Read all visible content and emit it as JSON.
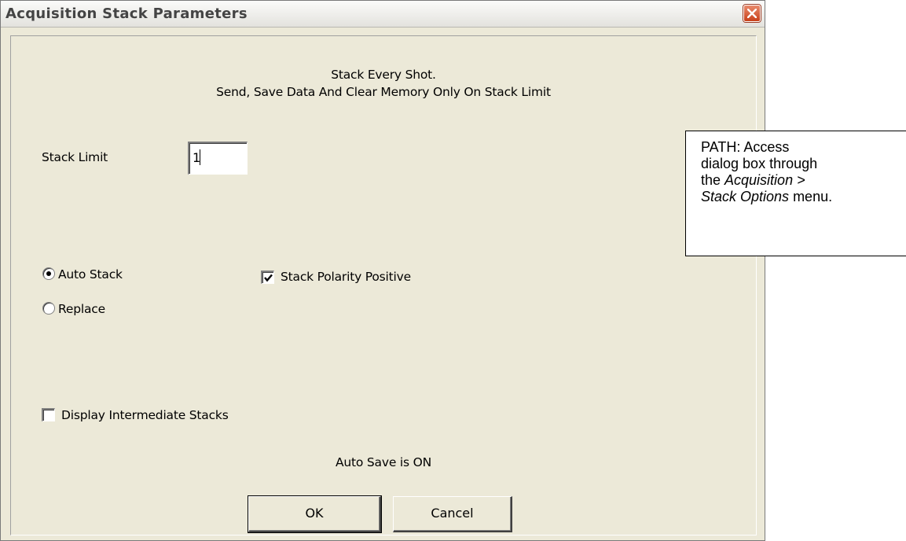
{
  "dialog": {
    "title": "Acquisition Stack Parameters",
    "header_line1": "Stack Every Shot.",
    "header_line2": "Send, Save Data And Clear Memory Only On Stack Limit",
    "stack_limit": {
      "label": "Stack Limit",
      "value": "1"
    },
    "mode_options": [
      {
        "label": "Auto Stack",
        "selected": true
      },
      {
        "label": "Replace",
        "selected": false
      }
    ],
    "stack_polarity": {
      "label": "Stack Polarity Positive",
      "checked": true
    },
    "display_intermediate": {
      "label": "Display Intermediate Stacks",
      "checked": false
    },
    "auto_save_status": "Auto Save is ON",
    "ok_label": "OK",
    "cancel_label": "Cancel"
  },
  "callout": {
    "line1": "PATH: Access",
    "line2": "dialog box through",
    "line3_prefix": "the ",
    "line3_italic": "Acquisition >",
    "line4_italic": "Stack Options",
    "line4_suffix": " menu."
  },
  "colors": {
    "dialog_bg": "#ece9d8",
    "close_button": "#c8401a"
  }
}
